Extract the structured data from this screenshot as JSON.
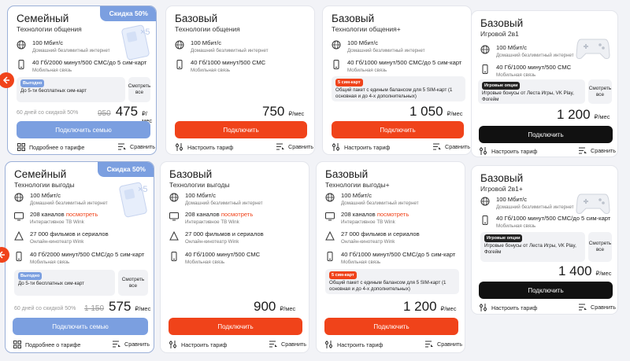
{
  "colors": {
    "accent": "#f0431a",
    "family_blue": "#7b9fe0",
    "black": "#111111"
  },
  "common": {
    "internet_main": "100 Мбит/с",
    "internet_sub": "Домашний безлимитный интернет",
    "mobile_sub": "Мобильная связь",
    "tv_sub": "Интерактивное ТВ Wink",
    "cinema_main": "27 000 фильмов и сериалов",
    "cinema_sub": "Онлайн-кинотеатр Wink",
    "watch_link": "посмотреть",
    "per_month": "₽/мес",
    "connect_family": "Подключить семью",
    "connect": "Подключить",
    "details": "Подробнее о тарифе",
    "configure": "Настроить тариф",
    "compare": "Сравнить",
    "see_all": "Смотреть все",
    "tag_profitable": "Выгодно",
    "five_free_sims": "До 5-ти бесплатных сим-карт",
    "tag_five_sims": "5 сим-карт",
    "shared_package": "Общий пакет с единым балансом для 5 SIM-карт (1 основная и до 4-х дополнительных)",
    "tag_game": "Игровые опции",
    "game_bonus": "Игровые бонусы от Леста Игры, VK Play, Фогейм"
  },
  "cards": [
    {
      "title": "Семейный",
      "subtitle": "Технологии общения",
      "badge": "Скидка 50%",
      "mobile_main": "40 Гб/2000 минут/500 СМС/до 5 сим-карт",
      "discount_text": "60 дней со скидкой 50%",
      "old_price": "950",
      "price": "475"
    },
    {
      "title": "Базовый",
      "subtitle": "Технологии общения",
      "mobile_main": "40 Гб/1000 минут/500 СМС",
      "price": "750"
    },
    {
      "title": "Базовый",
      "subtitle": "Технологии общения+",
      "mobile_main": "40 Гб/1000 минут/500 СМС/до 5 сим-карт",
      "price": "1 050"
    },
    {
      "title": "Базовый",
      "subtitle": "Игровой 2в1",
      "mobile_main": "40 Гб/1000 минут/500 СМС",
      "price": "1 200"
    },
    {
      "title": "Семейный",
      "subtitle": "Технологии выгоды",
      "badge": "Скидка 50%",
      "tv_main": "208 каналов",
      "mobile_main": "40 Гб/2000 минут/500 СМС/до 5 сим-карт",
      "discount_text": "60 дней со скидкой 50%",
      "old_price": "1 150",
      "price": "575"
    },
    {
      "title": "Базовый",
      "subtitle": "Технологии выгоды",
      "tv_main": "208 каналов",
      "mobile_main": "40 Гб/1000 минут/500 СМС",
      "price": "900"
    },
    {
      "title": "Базовый",
      "subtitle": "Технологии выгоды+",
      "tv_main": "208 каналов",
      "mobile_main": "40 Гб/1000 минут/500 СМС/до 5 сим-карт",
      "price": "1 200"
    },
    {
      "title": "Базовый",
      "subtitle": "Игровой 2в1+",
      "mobile_main": "40 Гб/1000 минут/500 СМС/до 5 сим-карт",
      "price": "1 400"
    }
  ]
}
